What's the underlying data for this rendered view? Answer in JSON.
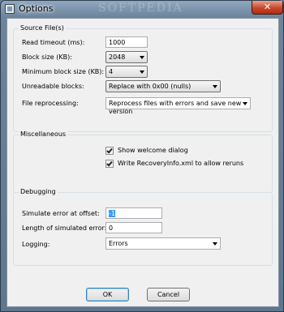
{
  "window": {
    "title": "Options",
    "watermark": "SOFTPEDIA",
    "close_glyph": "✕"
  },
  "source": {
    "title": "Source File(s)",
    "read_timeout_label": "Read timeout (ms):",
    "read_timeout_value": "1000",
    "block_size_label": "Block size (KB):",
    "block_size_value": "2048",
    "min_block_size_label": "Minimum block size (KB):",
    "min_block_size_value": "4",
    "unreadable_label": "Unreadable blocks:",
    "unreadable_value": "Replace with 0x00 (nulls)",
    "reprocessing_label": "File reprocessing:",
    "reprocessing_value": "Reprocess files with errors and save new version"
  },
  "misc": {
    "title": "Miscellaneous",
    "welcome_label": "Show welcome dialog",
    "welcome_checked": true,
    "recovery_label": "Write RecoveryInfo.xml to allow reruns",
    "recovery_checked": true
  },
  "debugging": {
    "title": "Debugging",
    "sim_offset_label": "Simulate error at offset:",
    "sim_offset_value": "-1",
    "sim_length_label": "Length of simulated error:",
    "sim_length_value": "0",
    "logging_label": "Logging:",
    "logging_value": "Errors"
  },
  "buttons": {
    "ok": "OK",
    "cancel": "Cancel"
  }
}
